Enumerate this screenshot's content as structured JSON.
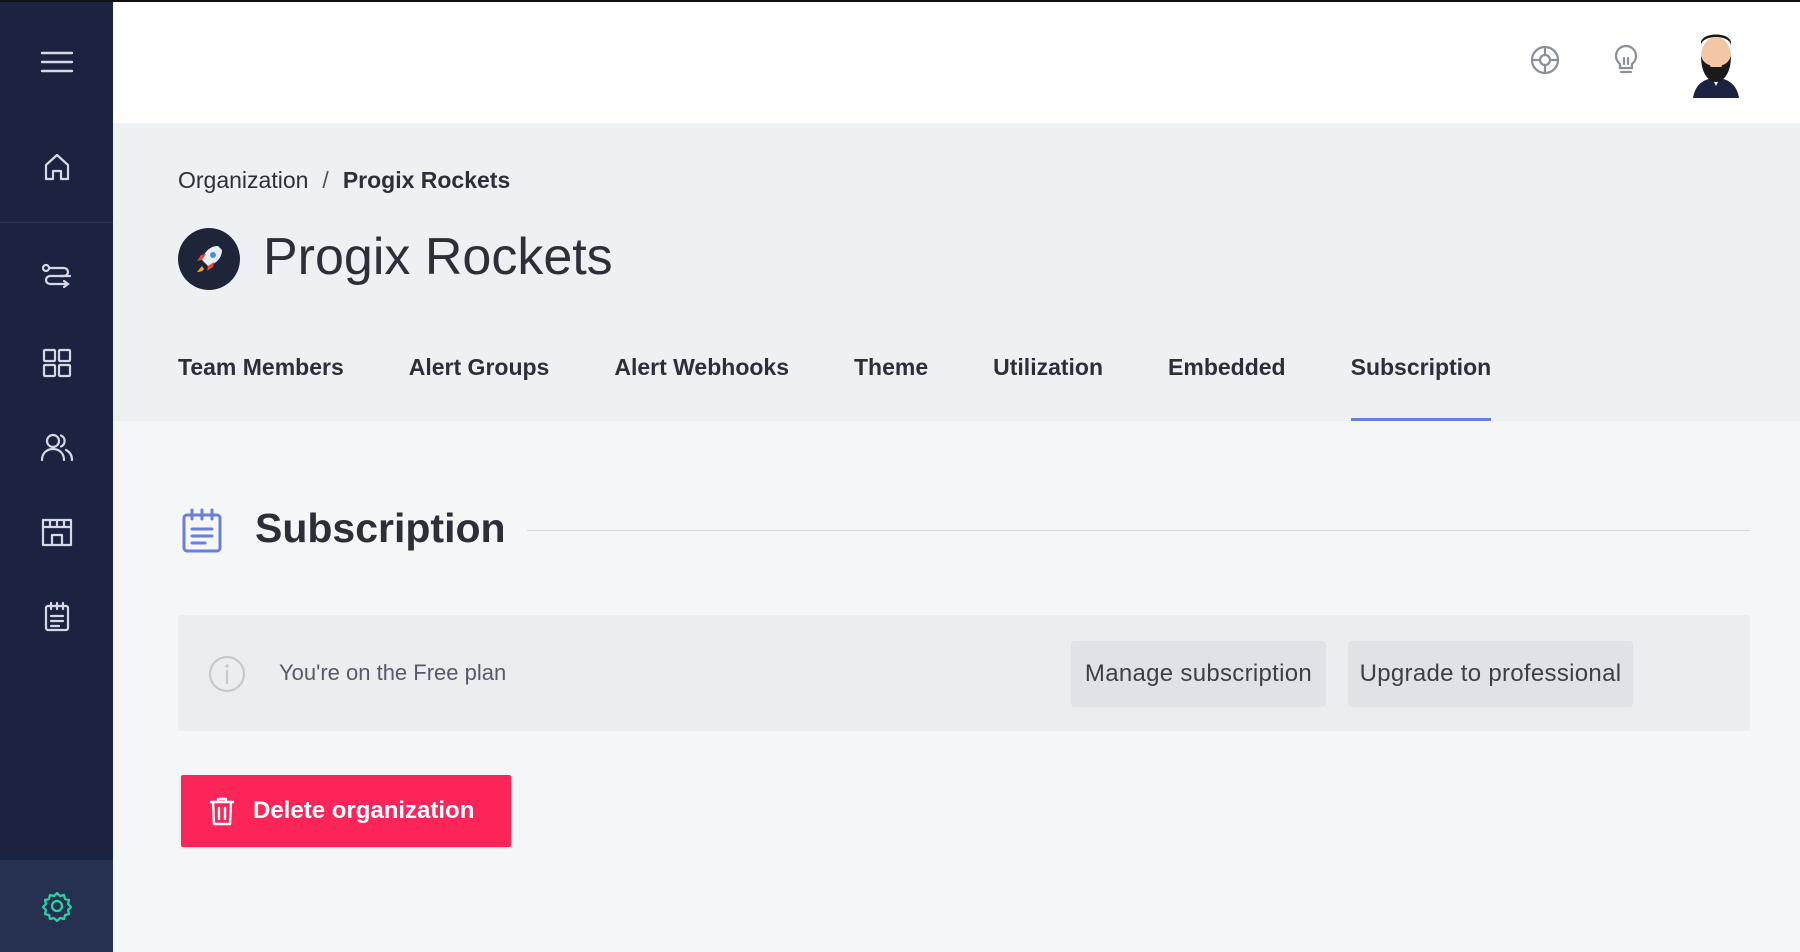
{
  "sidebar": {
    "items": [
      {
        "name": "menu-icon"
      },
      {
        "name": "home-icon"
      },
      {
        "name": "workflow-icon"
      },
      {
        "name": "grid-icon"
      },
      {
        "name": "users-icon"
      },
      {
        "name": "store-icon"
      },
      {
        "name": "notepad-icon"
      },
      {
        "name": "settings-icon"
      }
    ],
    "accent_color": "#2bd4a4"
  },
  "header": {
    "icons": [
      "help-icon",
      "lightbulb-icon",
      "avatar"
    ]
  },
  "breadcrumb": {
    "parent": "Organization",
    "separator": "/",
    "current": "Progix Rockets"
  },
  "org": {
    "title": "Progix Rockets",
    "logo_icon": "rocket-icon"
  },
  "tabs": [
    {
      "label": "Team Members",
      "active": false
    },
    {
      "label": "Alert Groups",
      "active": false
    },
    {
      "label": "Alert Webhooks",
      "active": false
    },
    {
      "label": "Theme",
      "active": false
    },
    {
      "label": "Utilization",
      "active": false
    },
    {
      "label": "Embedded",
      "active": false
    },
    {
      "label": "Subscription",
      "active": true
    }
  ],
  "section": {
    "title": "Subscription",
    "icon": "notepad-icon"
  },
  "plan": {
    "text": "You're on the Free plan",
    "manage_label": "Manage subscription",
    "upgrade_label": "Upgrade to professional"
  },
  "danger": {
    "delete_label": "Delete organization",
    "color": "#fc2559"
  },
  "colors": {
    "sidebar_bg": "#1b2340",
    "tab_underline": "#6b7fd7",
    "section_icon": "#6b7fd7"
  }
}
